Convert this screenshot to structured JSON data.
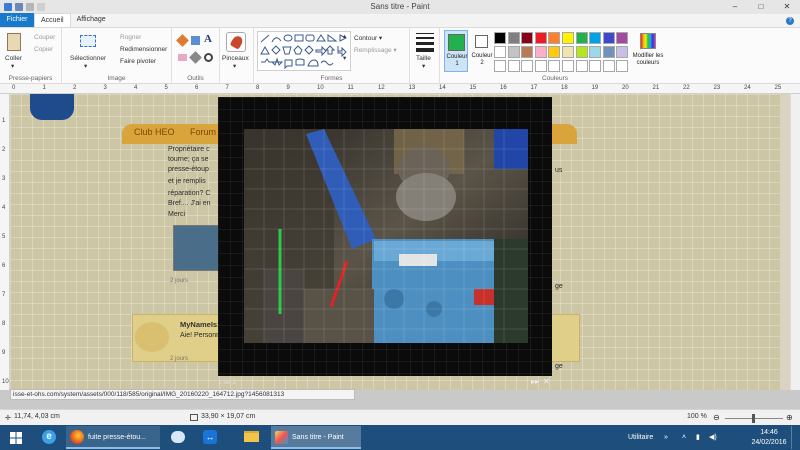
{
  "window": {
    "title": "Sans titre - Paint",
    "controls": [
      "–",
      "□",
      "✕"
    ]
  },
  "tabs": [
    "Fichier",
    "Accueil",
    "Affichage"
  ],
  "ribbon": {
    "clipboard": {
      "label": "Presse-papiers",
      "paste": "Coller",
      "cut": "Couper",
      "copy": "Copier"
    },
    "image": {
      "label": "Image",
      "select": "Sélectionner",
      "crop": "Rogner",
      "resize": "Redimensionner",
      "rotate": "Faire pivoter"
    },
    "tools": {
      "label": "Outils"
    },
    "brushes": {
      "label": "Pinceaux"
    },
    "shapes": {
      "label": "Formes",
      "outline": "Contour",
      "fill": "Remplissage"
    },
    "size": {
      "label": "Taille"
    },
    "colors": {
      "label": "Couleurs",
      "color1": "Couleur 1",
      "color2": "Couleur 2",
      "edit": "Modifier les couleurs",
      "color1_hex": "#22b14c",
      "color2_hex": "#ffffff",
      "palette_row1": [
        "#000000",
        "#7f7f7f",
        "#880015",
        "#ed1c24",
        "#ff7f27",
        "#fff200",
        "#22b14c",
        "#00a2e8",
        "#3f48cc",
        "#a349a4"
      ],
      "palette_row2": [
        "#ffffff",
        "#c3c3c3",
        "#b97a57",
        "#ffaec9",
        "#ffc90e",
        "#efe4b0",
        "#b5e61d",
        "#99d9ea",
        "#7092be",
        "#c8bfe7"
      ],
      "palette_row3": [
        "#ffffff",
        "#ffffff",
        "#ffffff",
        "#ffffff",
        "#ffffff",
        "#ffffff",
        "#ffffff",
        "#ffffff",
        "#ffffff",
        "#ffffff"
      ]
    }
  },
  "ruler": {
    "h": [
      "0",
      "1",
      "2",
      "3",
      "4",
      "5",
      "6",
      "7",
      "8",
      "9",
      "10",
      "11",
      "12",
      "13",
      "14",
      "15",
      "16",
      "17",
      "18",
      "19",
      "20",
      "21",
      "22",
      "23",
      "24",
      "25"
    ],
    "v": [
      "1",
      "2",
      "3",
      "4",
      "5",
      "6",
      "7",
      "8",
      "9",
      "10"
    ]
  },
  "forum": {
    "banner_left": "Club HEO",
    "banner_right": "Forum",
    "lines": [
      "Propriétaire c",
      "tourne; ça se",
      "presse-étoup",
      "et je remplis",
      "réparation? C",
      "Bref.... J'ai en",
      "Merci"
    ],
    "right_frag": "us",
    "right_frag2": "ge",
    "right_frag3": "ge",
    "username": "MyNameIs1",
    "reply": "Aie! Personne",
    "jours1": "2 jours",
    "jours2": "2 jours"
  },
  "lightbox": {
    "counter": "1 de 2",
    "next": "▸▸",
    "close": "✕"
  },
  "url": "isse-et-ohs.com/system/assets/000/118/585/original/IMG_20160220_164712.jpg?1456081313",
  "status": {
    "cursor": "11,74, 4,03 cm",
    "size": "33,90 × 19,07 cm",
    "zoom": "100 %"
  },
  "taskbar": {
    "browser": "fuite presse-étou...",
    "paint": "Sans titre - Paint",
    "tray_label": "Utilitaire",
    "time": "14:46",
    "date": "24/02/2016"
  }
}
